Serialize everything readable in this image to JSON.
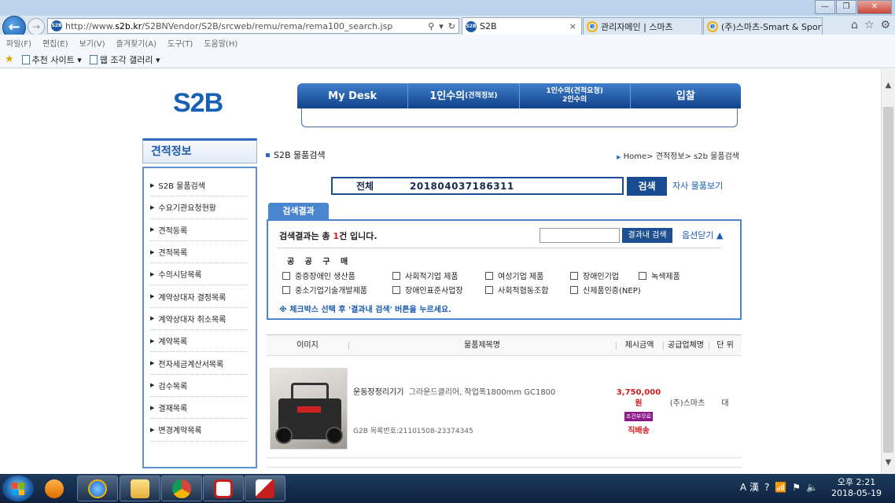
{
  "browser": {
    "url_prefix": "http://www.",
    "url_domain": "s2b.kr",
    "url_path": "/S2BNVendor/S2B/srcweb/remu/rema/rema100_search.jsp",
    "favicon_text": "S2B",
    "tabs": [
      {
        "label": "S2B",
        "close": "×"
      },
      {
        "label": "관리자메인 | 스마츠",
        "close": ""
      },
      {
        "label": "(주)스마츠-Smart & Sports...",
        "close": ""
      }
    ],
    "menu": [
      "파일(F)",
      "편집(E)",
      "보기(V)",
      "즐겨찾기(A)",
      "도구(T)",
      "도움말(H)"
    ],
    "favorites": [
      "추천 사이트 ▾",
      "웹 조각 갤러리 ▾"
    ]
  },
  "site": {
    "logo": "S2B",
    "topnav": [
      {
        "label": "My Desk",
        "sub": ""
      },
      {
        "label": "1인수의",
        "sub": "(견적정보)"
      },
      {
        "label": "1인수의(견적요청)",
        "sub": "2인수의"
      },
      {
        "label": "입찰",
        "sub": ""
      }
    ]
  },
  "sidebar": {
    "title": "견적정보",
    "items": [
      {
        "label": "S2B 물품검색"
      },
      {
        "label": "수요기관요청현황"
      },
      {
        "label": "견적등록"
      },
      {
        "label": "견적목록"
      },
      {
        "label": "수의시담목록"
      },
      {
        "label": "계약상대자 결정목록"
      },
      {
        "label": "계약상대자 취소목록"
      },
      {
        "label": "계약목록"
      },
      {
        "label": "전자세금계산서목록"
      },
      {
        "label": "검수목록"
      },
      {
        "label": "결재목록"
      },
      {
        "label": "변경계약목록"
      }
    ]
  },
  "main": {
    "section_title": "S2B 물품검색",
    "breadcrumb": "Home> 견적정보> s2b 물품검색",
    "search": {
      "category": "전체",
      "value": "201804037186311",
      "button": "검색",
      "own_products_link": "자사 물품보기"
    },
    "result_tab": "검색결과",
    "summary_prefix": "검색결과는 총",
    "summary_count": "1",
    "summary_suffix": "건 입니다.",
    "inner_search_button": "결과내 검색",
    "options_toggle": "옵션닫기",
    "purchase_label": "공 공 구 매",
    "checkboxes": [
      "중증장애인 생산품",
      "사회적기업 제품",
      "여성기업 제품",
      "장애인기업",
      "녹색제품",
      "중소기업기술개발제품",
      "장애인표준사업장",
      "사회적협동조합",
      "신제품인증(NEP)"
    ],
    "notice": "※ 체크박스 선택 후 '결과내 검색' 버튼을 누르세요.",
    "table_headers": [
      "이미지",
      "물품제목명",
      "제시금액",
      "공급업체명",
      "단 위"
    ],
    "product": {
      "name": "운동장정리기기",
      "spec": "그라운드클리어, 작업폭1800mm  GC1800",
      "code": "G2B 목록번호:21101508-23374345",
      "price": "3,750,000",
      "currency": "원",
      "badge": "조건부무료",
      "shipping": "직배송",
      "supplier": "(주)스마츠",
      "unit": "대"
    }
  },
  "taskbar": {
    "time": "오후 2:21",
    "date": "2018-05-19",
    "ime": "A 漢"
  }
}
